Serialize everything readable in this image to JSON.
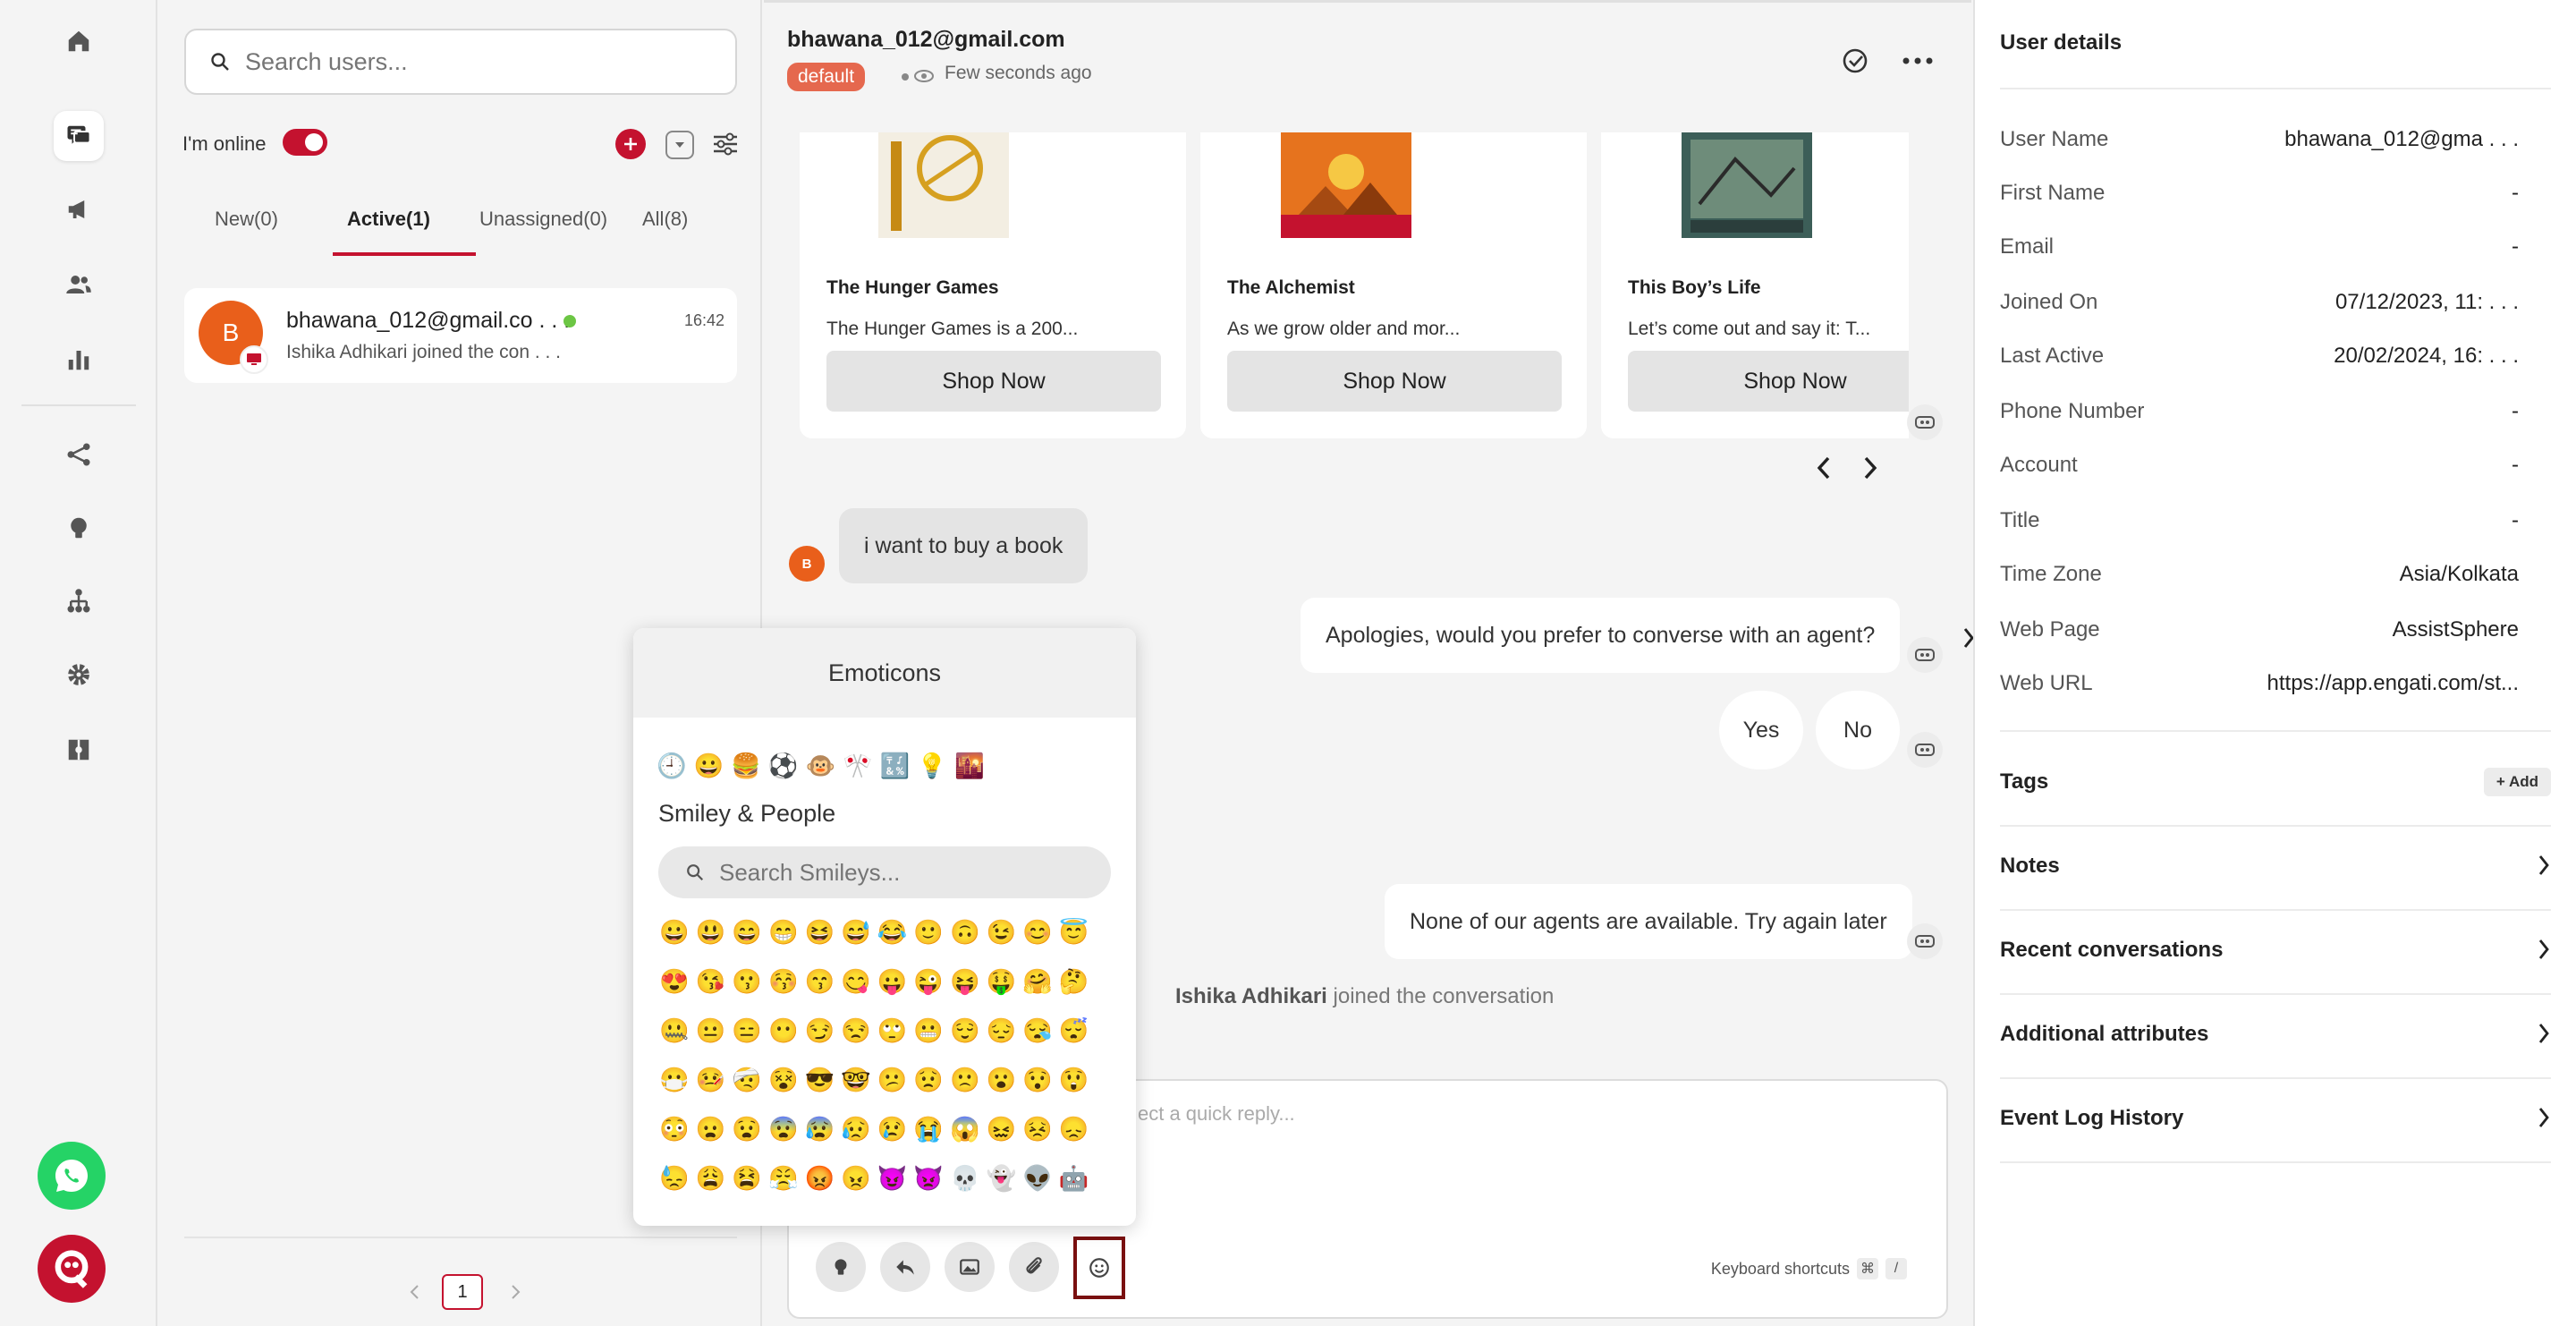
{
  "nav": {
    "items": [
      "home-icon",
      "chat-icon",
      "megaphone-icon",
      "users-icon",
      "bar-chart-icon",
      "flow-icon",
      "bulb-icon",
      "hierarchy-icon",
      "gear-icon",
      "puzzle-icon"
    ],
    "brand_colors": {
      "whatsapp": "#25d366",
      "engati": "#c4122f"
    }
  },
  "user_list": {
    "search_placeholder": "Search users...",
    "online_label": "I'm online",
    "tabs": [
      {
        "label": "New(0)"
      },
      {
        "label": "Active(1)"
      },
      {
        "label": "Unassigned(0)"
      },
      {
        "label": "All(8)"
      }
    ],
    "conversation": {
      "avatar_letter": "B",
      "name": "bhawana_012@gmail.co . . .",
      "time": "16:42",
      "preview": "Ishika Adhikari joined the con . . ."
    },
    "page": "1"
  },
  "chat": {
    "header_name": "bhawana_012@gmail.com",
    "badge": "default",
    "status": "Few seconds ago",
    "cards": [
      {
        "title": "The Hunger Games",
        "desc": "The Hunger Games is a 200...",
        "button": "Shop Now"
      },
      {
        "title": "The Alchemist",
        "desc": "As we grow older and mor...",
        "button": "Shop Now"
      },
      {
        "title": "This Boy’s Life",
        "desc": "Let’s come out and say it: T...",
        "button": "Shop Now"
      }
    ],
    "user_avatar": "B",
    "user_message": "i want to buy a book",
    "bot_message_1": "Apologies, would you prefer to converse with an agent?",
    "quick_replies": [
      "Yes",
      "No"
    ],
    "bot_message_2": "None of our agents are available. Try again later",
    "system_name": "Ishika Adhikari",
    "system_text": "joined the conversation",
    "composer_placeholder": "ect a quick reply...",
    "keyboard_shortcuts": "Keyboard shortcuts",
    "kbd_1": "⌘",
    "kbd_2": "/"
  },
  "emoticons": {
    "title": "Emoticons",
    "categories": [
      "🕘",
      "😀",
      "🍔",
      "⚽",
      "🐵",
      "🎌",
      "🔣",
      "💡",
      "🌇"
    ],
    "category_title": "Smiley & People",
    "search_placeholder": "Search Smileys...",
    "emojis": [
      "😀",
      "😃",
      "😄",
      "😁",
      "😆",
      "😅",
      "😂",
      "🙂",
      "🙃",
      "😉",
      "😊",
      "😇",
      "😍",
      "😘",
      "😗",
      "😚",
      "😙",
      "😋",
      "😛",
      "😜",
      "😝",
      "🤑",
      "🤗",
      "🤔",
      "🤐",
      "😐",
      "😑",
      "😶",
      "😏",
      "😒",
      "🙄",
      "😬",
      "😌",
      "😔",
      "😪",
      "😴",
      "😷",
      "🤒",
      "🤕",
      "😵",
      "😎",
      "🤓",
      "😕",
      "😟",
      "🙁",
      "😮",
      "😯",
      "😲",
      "😳",
      "😦",
      "😧",
      "😨",
      "😰",
      "😥",
      "😢",
      "😭",
      "😱",
      "😖",
      "😣",
      "😞",
      "😓",
      "😩",
      "😫",
      "😤",
      "😡",
      "😠",
      "😈",
      "👿",
      "💀",
      "👻",
      "👽",
      "🤖"
    ]
  },
  "details": {
    "title": "User details",
    "rows": [
      {
        "label": "User Name",
        "value": "bhawana_012@gma . . ."
      },
      {
        "label": "First Name",
        "value": "-"
      },
      {
        "label": "Email",
        "value": "-"
      },
      {
        "label": "Joined On",
        "value": "07/12/2023, 11: . . ."
      },
      {
        "label": "Last Active",
        "value": "20/02/2024, 16: . . ."
      },
      {
        "label": "Phone Number",
        "value": "-"
      },
      {
        "label": "Account",
        "value": "-"
      },
      {
        "label": "Title",
        "value": "-"
      },
      {
        "label": "Time Zone",
        "value": "Asia/Kolkata"
      },
      {
        "label": "Web Page",
        "value": "AssistSphere"
      },
      {
        "label": "Web URL",
        "value": "https://app.engati.com/st..."
      }
    ],
    "tags_label": "Tags",
    "add_label": "+ Add",
    "sections": [
      "Notes",
      "Recent conversations",
      "Additional attributes",
      "Event Log History"
    ]
  }
}
